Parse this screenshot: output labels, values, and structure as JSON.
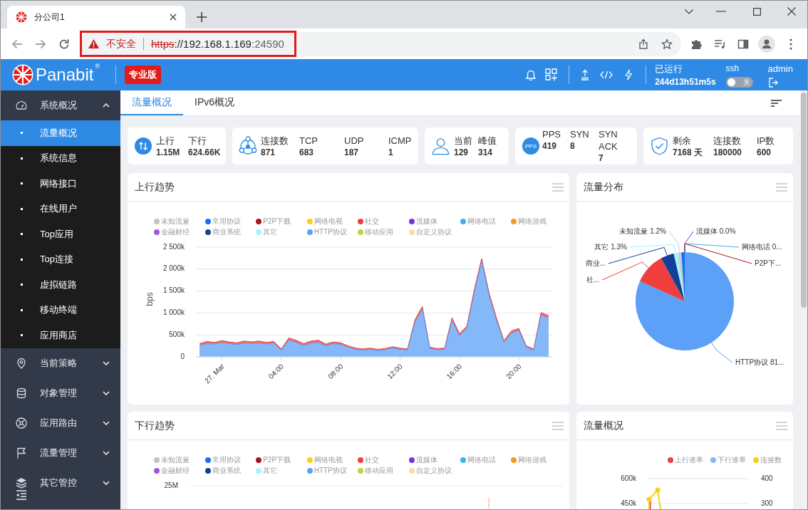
{
  "browser": {
    "tab": {
      "title": "分公司1",
      "selected": true
    },
    "address": {
      "security": "不安全",
      "scheme": "https",
      "host": "://192.168.1.169",
      "port": ":24590"
    }
  },
  "header": {
    "brand": "Panabit$^{®}$",
    "edition": "专业版",
    "uptime_label": "已运行",
    "uptime": "244d13h51m5s",
    "ssh": {
      "label": "ssh",
      "on": false,
      "state_text": "关"
    },
    "user": "admin"
  },
  "sidebar": {
    "groups": [
      {
        "label": "系统概况",
        "expanded": true,
        "children": [
          {
            "label": "流量概况",
            "selected": true
          },
          {
            "label": "系统信息",
            "selected": false
          },
          {
            "label": "网络接口",
            "selected": false
          },
          {
            "label": "在线用户",
            "selected": false
          },
          {
            "label": "Top应用",
            "selected": false
          },
          {
            "label": "Top连接",
            "selected": false
          },
          {
            "label": "虚拟链路",
            "selected": false
          },
          {
            "label": "移动终端",
            "selected": false
          },
          {
            "label": "应用商店",
            "selected": false
          }
        ]
      },
      {
        "label": "当前策略",
        "expanded": false
      },
      {
        "label": "对象管理",
        "expanded": false
      },
      {
        "label": "应用路由",
        "expanded": false
      },
      {
        "label": "流量管理",
        "expanded": false
      },
      {
        "label": "其它管控",
        "expanded": false
      }
    ]
  },
  "tabs": [
    {
      "label": "流量概况",
      "selected": true
    },
    {
      "label": "IPv6概况",
      "selected": false
    }
  ],
  "stats": [
    {
      "metrics": [
        {
          "label": "上行",
          "value": "1.15M"
        },
        {
          "label": "下行",
          "value": "624.66K"
        }
      ]
    },
    {
      "metrics": [
        {
          "label": "连接数",
          "value": "871"
        },
        {
          "label": "TCP",
          "value": "683"
        },
        {
          "label": "UDP",
          "value": "187"
        },
        {
          "label": "ICMP",
          "value": "1"
        }
      ]
    },
    {
      "metrics": [
        {
          "label": "当前",
          "value": "129"
        },
        {
          "label": "峰值",
          "value": "314"
        }
      ]
    },
    {
      "badge": "PPS",
      "metrics": [
        {
          "label": "PPS",
          "value": "419"
        },
        {
          "label": "SYN",
          "value": "8"
        },
        {
          "label": "SYN ACK",
          "value": "7"
        }
      ]
    },
    {
      "metrics": [
        {
          "label": "剩余",
          "value": "7168 天"
        },
        {
          "label": "连接数",
          "value": "180000"
        },
        {
          "label": "IP数",
          "value": "600"
        }
      ]
    }
  ],
  "upload_trend": {
    "title": "上行趋势",
    "chart_data": {
      "type": "area",
      "stacked": false,
      "grid": true,
      "legend": "top",
      "ylabel": "bps",
      "xlim": [
        -1.75,
        22.25
      ],
      "ylim": [
        0,
        2500000
      ],
      "xticks": [
        {
          "value": 0,
          "label": "27. Mar"
        },
        {
          "value": 4,
          "label": "04:00"
        },
        {
          "value": 8,
          "label": "08:00"
        },
        {
          "value": 12,
          "label": "12:00"
        },
        {
          "value": 16,
          "label": "16:00"
        },
        {
          "value": 20,
          "label": "20:00"
        }
      ],
      "yticks": [
        {
          "value": 0,
          "label": "0"
        },
        {
          "value": 500000,
          "label": "500k"
        },
        {
          "value": 1000000,
          "label": "1 000k"
        },
        {
          "value": 1500000,
          "label": "1 500k"
        },
        {
          "value": 2000000,
          "label": "2 000k"
        },
        {
          "value": 2500000,
          "label": "2 500k"
        }
      ],
      "x": [
        -1.5,
        -1,
        -0.5,
        0,
        0.5,
        1,
        1.5,
        2,
        2.5,
        3,
        3.5,
        4,
        4.5,
        5,
        5.5,
        6,
        6.5,
        7,
        7.5,
        8,
        8.5,
        9,
        9.5,
        10,
        10.5,
        11,
        11.5,
        12,
        12.5,
        13,
        13.5,
        14,
        14.5,
        15,
        15.5,
        16,
        16.5,
        17,
        17.5,
        18,
        18.5,
        19,
        19.5,
        20,
        20.5,
        21,
        21.5,
        22
      ],
      "series": [
        {
          "name": "未知流量",
          "color": "#bfc4c9",
          "values": [
            null,
            null,
            null,
            null,
            null,
            null,
            null,
            null,
            null,
            null,
            null,
            null,
            null,
            null,
            null,
            null,
            null,
            null,
            null,
            null,
            null,
            null,
            null,
            null,
            null,
            null,
            null,
            null,
            null,
            null,
            null,
            null,
            null,
            null,
            null,
            null,
            null,
            null,
            null,
            null,
            null,
            null,
            null,
            null,
            null,
            null,
            null,
            null
          ]
        },
        {
          "name": "常用协议",
          "color": "#1670f0",
          "values": [
            null,
            null,
            null,
            null,
            null,
            null,
            null,
            null,
            null,
            null,
            null,
            null,
            null,
            null,
            null,
            null,
            null,
            null,
            null,
            null,
            null,
            null,
            null,
            null,
            null,
            null,
            null,
            null,
            null,
            null,
            null,
            null,
            null,
            null,
            null,
            null,
            null,
            null,
            null,
            null,
            null,
            null,
            null,
            null,
            null,
            null,
            null,
            null
          ]
        },
        {
          "name": "P2P下载",
          "color": "#a8161b",
          "values": [
            null,
            null,
            null,
            null,
            null,
            null,
            null,
            null,
            null,
            null,
            null,
            null,
            null,
            null,
            null,
            null,
            null,
            null,
            null,
            null,
            null,
            null,
            null,
            null,
            null,
            null,
            null,
            null,
            null,
            null,
            null,
            null,
            null,
            null,
            null,
            null,
            null,
            null,
            null,
            null,
            null,
            null,
            null,
            null,
            null,
            null,
            null,
            null
          ]
        },
        {
          "name": "网络电视",
          "color": "#f7d117",
          "values": [
            null,
            null,
            null,
            null,
            null,
            null,
            null,
            null,
            null,
            null,
            null,
            null,
            null,
            null,
            null,
            null,
            null,
            null,
            null,
            null,
            null,
            null,
            null,
            null,
            null,
            null,
            null,
            null,
            null,
            null,
            null,
            null,
            null,
            null,
            null,
            null,
            null,
            null,
            null,
            null,
            null,
            null,
            null,
            null,
            null,
            null,
            null,
            null
          ]
        },
        {
          "name": "社交",
          "color": "#ee3e3e",
          "values": [
            300000,
            350000,
            330000,
            370000,
            340000,
            320000,
            360000,
            340000,
            360000,
            330000,
            350000,
            180000,
            430000,
            380000,
            300000,
            360000,
            380000,
            290000,
            340000,
            320000,
            250000,
            200000,
            180000,
            200000,
            170000,
            190000,
            230000,
            200000,
            180000,
            840000,
            1150000,
            220000,
            190000,
            200000,
            890000,
            530000,
            700000,
            1530000,
            2240000,
            1450000,
            880000,
            370000,
            590000,
            650000,
            250000,
            180000,
            1010000,
            940000
          ]
        },
        {
          "name": "流媒体",
          "color": "#6f38dc",
          "values": [
            null,
            null,
            null,
            null,
            null,
            null,
            null,
            null,
            null,
            null,
            null,
            null,
            null,
            null,
            null,
            null,
            null,
            null,
            null,
            null,
            null,
            null,
            null,
            null,
            null,
            null,
            null,
            null,
            null,
            null,
            null,
            null,
            null,
            null,
            null,
            null,
            null,
            null,
            null,
            null,
            null,
            null,
            null,
            null,
            null,
            null,
            null,
            null
          ]
        },
        {
          "name": "网络电话",
          "color": "#36b3f1",
          "values": [
            null,
            null,
            null,
            null,
            null,
            null,
            null,
            null,
            null,
            null,
            null,
            null,
            null,
            null,
            null,
            null,
            null,
            null,
            null,
            null,
            null,
            null,
            null,
            null,
            null,
            null,
            null,
            null,
            null,
            null,
            null,
            null,
            null,
            null,
            null,
            null,
            null,
            null,
            null,
            null,
            null,
            null,
            null,
            null,
            null,
            null,
            null,
            null
          ]
        },
        {
          "name": "网络游戏",
          "color": "#f29b27",
          "values": [
            null,
            null,
            null,
            null,
            null,
            null,
            null,
            null,
            null,
            null,
            null,
            null,
            null,
            null,
            null,
            null,
            null,
            null,
            null,
            null,
            null,
            null,
            null,
            null,
            null,
            null,
            null,
            null,
            null,
            null,
            null,
            null,
            null,
            null,
            null,
            null,
            null,
            null,
            null,
            null,
            null,
            null,
            null,
            null,
            null,
            null,
            null,
            null
          ]
        },
        {
          "name": "金融财经",
          "color": "#a356e3",
          "values": [
            null,
            null,
            null,
            null,
            null,
            null,
            null,
            null,
            null,
            null,
            null,
            null,
            null,
            null,
            null,
            null,
            null,
            null,
            null,
            null,
            null,
            null,
            null,
            null,
            null,
            null,
            null,
            null,
            null,
            null,
            null,
            null,
            null,
            null,
            null,
            null,
            null,
            null,
            null,
            null,
            null,
            null,
            null,
            null,
            null,
            null,
            null,
            null
          ]
        },
        {
          "name": "商业系统",
          "color": "#123f98",
          "values": [
            null,
            null,
            null,
            null,
            null,
            null,
            null,
            null,
            null,
            null,
            null,
            null,
            null,
            null,
            null,
            null,
            null,
            null,
            null,
            null,
            null,
            null,
            null,
            null,
            null,
            null,
            null,
            null,
            null,
            null,
            null,
            null,
            null,
            null,
            null,
            null,
            null,
            null,
            null,
            null,
            null,
            null,
            null,
            null,
            null,
            null,
            null,
            null
          ]
        },
        {
          "name": "其它",
          "color": "#a2f5fb",
          "values": [
            null,
            null,
            null,
            null,
            null,
            null,
            null,
            null,
            null,
            null,
            null,
            null,
            null,
            null,
            null,
            null,
            null,
            null,
            null,
            null,
            null,
            null,
            null,
            null,
            null,
            null,
            null,
            null,
            null,
            null,
            null,
            null,
            null,
            null,
            null,
            null,
            null,
            null,
            null,
            null,
            null,
            null,
            null,
            null,
            null,
            null,
            null,
            null
          ]
        },
        {
          "name": "HTTP协议",
          "color": "#5ca0f7",
          "values": [
            260000,
            300000,
            290000,
            320000,
            300000,
            280000,
            310000,
            300000,
            310000,
            290000,
            310000,
            150000,
            380000,
            330000,
            260000,
            310000,
            330000,
            250000,
            300000,
            280000,
            220000,
            170000,
            150000,
            170000,
            140000,
            160000,
            200000,
            170000,
            150000,
            780000,
            1080000,
            190000,
            160000,
            170000,
            830000,
            480000,
            650000,
            1450000,
            2180000,
            1380000,
            820000,
            330000,
            540000,
            600000,
            220000,
            150000,
            950000,
            880000
          ]
        },
        {
          "name": "移动应用",
          "color": "#b7d838",
          "values": [
            null,
            null,
            null,
            null,
            null,
            null,
            null,
            null,
            null,
            null,
            null,
            null,
            null,
            null,
            null,
            null,
            null,
            null,
            null,
            null,
            null,
            null,
            null,
            null,
            null,
            null,
            null,
            null,
            null,
            null,
            null,
            null,
            null,
            null,
            null,
            null,
            null,
            null,
            null,
            null,
            null,
            null,
            null,
            null,
            null,
            null,
            null,
            null
          ]
        },
        {
          "name": "自定义协议",
          "color": "#f7dea2",
          "values": [
            null,
            null,
            null,
            null,
            null,
            null,
            null,
            null,
            null,
            null,
            null,
            null,
            null,
            null,
            null,
            null,
            null,
            null,
            null,
            null,
            null,
            null,
            null,
            null,
            null,
            null,
            null,
            null,
            null,
            null,
            null,
            null,
            null,
            null,
            null,
            null,
            null,
            null,
            null,
            null,
            null,
            null,
            null,
            null,
            null,
            null,
            null,
            null
          ]
        }
      ]
    }
  },
  "distribution": {
    "title": "流量分布",
    "chart_data": {
      "type": "pie",
      "categories": [
        "HTTP协议 81...",
        "社...",
        "商业...",
        "其它 1.3%",
        "未知流量 1.2%",
        null,
        "流媒体 0.0%",
        "网络电话 0...",
        "P2P下..."
      ],
      "values": [
        81.7,
        10.3,
        4.4,
        1.3,
        1.2,
        1.1,
        0.0,
        0.0,
        0.0
      ],
      "colors": [
        "#5ca0f7",
        "#ee3e3e",
        "#123f98",
        "#a2f5fb",
        "#c9cbce",
        "#1670f0",
        "#6f38dc",
        "#36b3f1",
        "#a8161b"
      ]
    }
  },
  "download_trend": {
    "title": "下行趋势",
    "legend": [
      {
        "name": "未知流量",
        "color": "#bfc4c9"
      },
      {
        "name": "常用协议",
        "color": "#1670f0"
      },
      {
        "name": "P2P下载",
        "color": "#a8161b"
      },
      {
        "name": "网络电视",
        "color": "#f7d117"
      },
      {
        "name": "社交",
        "color": "#ee3e3e"
      },
      {
        "name": "流媒体",
        "color": "#6f38dc"
      },
      {
        "name": "网络电话",
        "color": "#36b3f1"
      },
      {
        "name": "网络游戏",
        "color": "#f29b27"
      },
      {
        "name": "金融财经",
        "color": "#a356e3"
      },
      {
        "name": "商业系统",
        "color": "#123f98"
      },
      {
        "name": "其它",
        "color": "#a2f5fb"
      },
      {
        "name": "HTTP协议",
        "color": "#5ca0f7"
      },
      {
        "name": "移动应用",
        "color": "#b7d838"
      },
      {
        "name": "自定义协议",
        "color": "#f7dea2"
      }
    ],
    "y_tick_labels": [
      "25M"
    ]
  },
  "overview": {
    "title": "流量概况",
    "legend": [
      {
        "name": "上行速率",
        "color": "#ee3e3e"
      },
      {
        "name": "下行速率",
        "color": "#86b6f6"
      },
      {
        "name": "连接数",
        "color": "#f7d117"
      }
    ],
    "left_axis_labels": [
      "600k",
      "450k"
    ],
    "right_axis_labels": [
      "400",
      "300"
    ]
  }
}
